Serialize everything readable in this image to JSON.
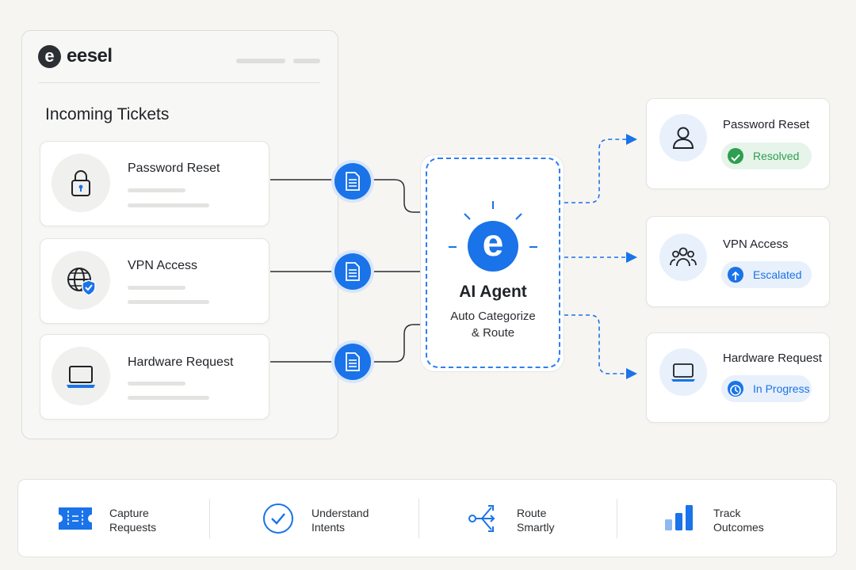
{
  "brand": {
    "logo_letter": "e",
    "name": "eesel"
  },
  "incoming": {
    "title": "Incoming Tickets",
    "tickets": [
      {
        "title": "Password Reset",
        "icon": "lock-icon"
      },
      {
        "title": "VPN Access",
        "icon": "globe-shield-icon"
      },
      {
        "title": "Hardware Request",
        "icon": "laptop-icon"
      }
    ]
  },
  "agent": {
    "logo_letter": "e",
    "title": "AI Agent",
    "subtitle_line1": "Auto Categorize",
    "subtitle_line2": "& Route"
  },
  "results": [
    {
      "title": "Password Reset",
      "status": "Resolved",
      "icon": "user-icon",
      "status_icon": "check-icon"
    },
    {
      "title": "VPN Access",
      "status": "Escalated",
      "icon": "users-icon",
      "status_icon": "arrow-up-icon"
    },
    {
      "title": "Hardware Request",
      "status": "In Progress",
      "icon": "laptop-icon",
      "status_icon": "clock-icon"
    }
  ],
  "steps": [
    {
      "line1": "Capture",
      "line2": "Requests",
      "icon": "ticket-icon"
    },
    {
      "line1": "Understand",
      "line2": "Intents",
      "icon": "check-circle-icon"
    },
    {
      "line1": "Route",
      "line2": "Smartly",
      "icon": "route-icon"
    },
    {
      "line1": "Track",
      "line2": "Outcomes",
      "icon": "bar-chart-icon"
    }
  ],
  "colors": {
    "accent": "#1a73e8",
    "resolved_bg": "#e6f4ea",
    "resolved": "#2e9e4f",
    "escalated_bg": "#e8f0fc",
    "progress_bg": "#e8f0fc"
  }
}
